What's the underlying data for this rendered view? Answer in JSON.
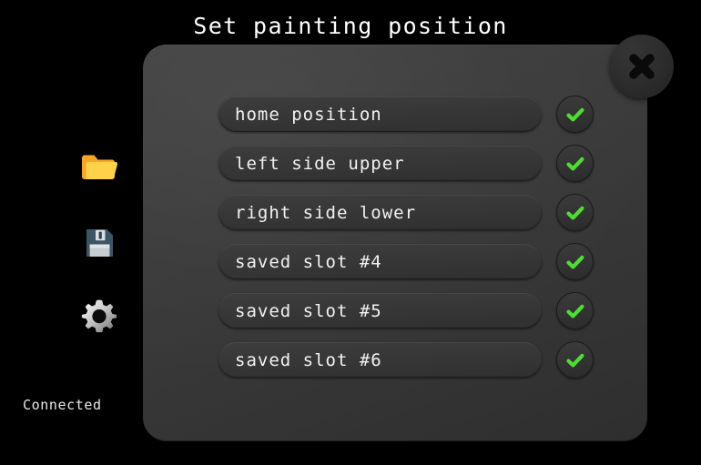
{
  "window": {
    "title": "Set painting position",
    "background_color": "#000000"
  },
  "sidebar": {
    "items": [
      {
        "icon": "folder-icon",
        "name": "open-folder"
      },
      {
        "icon": "floppy-disk-icon",
        "name": "save"
      },
      {
        "icon": "gear-icon",
        "name": "settings"
      }
    ],
    "status": {
      "label": "Connected",
      "color": "#e8e8e8"
    }
  },
  "dialog": {
    "panel_color": "#3a3a3a",
    "close_button": {
      "icon": "close-icon",
      "label": "✕"
    },
    "slots": [
      {
        "label": "home position",
        "confirm_icon": "check-icon",
        "checked": true
      },
      {
        "label": "left side upper",
        "confirm_icon": "check-icon",
        "checked": true
      },
      {
        "label": "right side lower",
        "confirm_icon": "check-icon",
        "checked": true
      },
      {
        "label": "saved slot #4",
        "confirm_icon": "check-icon",
        "checked": true
      },
      {
        "label": "saved slot #5",
        "confirm_icon": "check-icon",
        "checked": true
      },
      {
        "label": "saved slot #6",
        "confirm_icon": "check-icon",
        "checked": true
      }
    ],
    "accent_color": "#4ddd33"
  }
}
